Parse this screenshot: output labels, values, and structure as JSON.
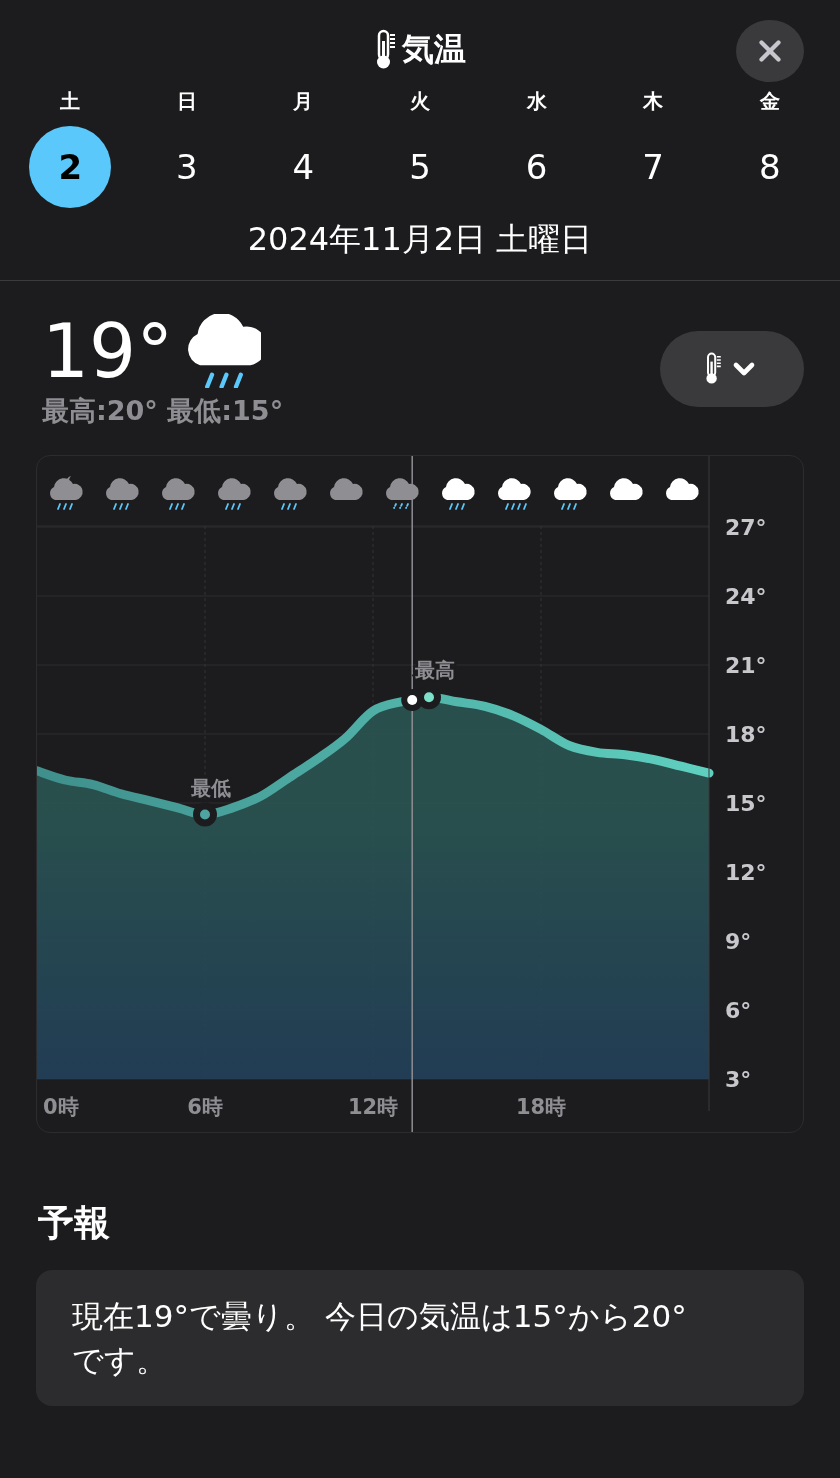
{
  "header": {
    "title": "気温"
  },
  "days": [
    {
      "weekday": "土",
      "date": "2",
      "selected": true
    },
    {
      "weekday": "日",
      "date": "3",
      "selected": false
    },
    {
      "weekday": "月",
      "date": "4",
      "selected": false
    },
    {
      "weekday": "火",
      "date": "5",
      "selected": false
    },
    {
      "weekday": "水",
      "date": "6",
      "selected": false
    },
    {
      "weekday": "木",
      "date": "7",
      "selected": false
    },
    {
      "weekday": "金",
      "date": "8",
      "selected": false
    }
  ],
  "selected_date": "2024年11月2日 土曜日",
  "current": {
    "temperature": "19°",
    "high_low": "最高:20° 最低:15°"
  },
  "conditions": [
    {
      "kind": "night-rain",
      "past": true
    },
    {
      "kind": "rain",
      "past": true
    },
    {
      "kind": "rain",
      "past": true
    },
    {
      "kind": "rain",
      "past": true
    },
    {
      "kind": "rain",
      "past": true
    },
    {
      "kind": "cloud",
      "past": true
    },
    {
      "kind": "drizzle",
      "past": true
    },
    {
      "kind": "rain",
      "past": false
    },
    {
      "kind": "heavy-rain",
      "past": false
    },
    {
      "kind": "rain",
      "past": false
    },
    {
      "kind": "cloud",
      "past": false
    },
    {
      "kind": "cloud",
      "past": false
    }
  ],
  "chart_data": {
    "type": "area",
    "x": [
      0,
      1,
      2,
      3,
      4,
      5,
      6,
      7,
      8,
      9,
      10,
      11,
      12,
      13,
      14,
      15,
      16,
      17,
      18,
      19,
      20,
      21,
      22,
      23,
      24
    ],
    "grid": true,
    "series": [
      {
        "color": "#5fd0c0",
        "values": [
          16.4,
          16.0,
          15.8,
          15.4,
          15.1,
          14.8,
          14.5,
          14.8,
          15.3,
          16.1,
          16.9,
          17.8,
          19.0,
          19.4,
          19.6,
          19.4,
          19.2,
          18.8,
          18.2,
          17.5,
          17.2,
          17.1,
          16.9,
          16.6,
          16.3
        ]
      }
    ],
    "xlim": [
      0,
      24
    ],
    "ylim": [
      3,
      30
    ],
    "xticks": [
      {
        "value": 0,
        "label": "0時"
      },
      {
        "value": 6,
        "label": "6時"
      },
      {
        "value": 12,
        "label": "12時"
      },
      {
        "value": 18,
        "label": "18時"
      }
    ],
    "yticks": [
      {
        "value": 3,
        "label": "3°"
      },
      {
        "value": 6,
        "label": "6°"
      },
      {
        "value": 9,
        "label": "9°"
      },
      {
        "value": 12,
        "label": "12°"
      },
      {
        "value": 15,
        "label": "15°"
      },
      {
        "value": 18,
        "label": "18°"
      },
      {
        "value": 21,
        "label": "21°"
      },
      {
        "value": 24,
        "label": "24°"
      },
      {
        "value": 27,
        "label": "27°"
      }
    ],
    "annotations": [
      {
        "x": 6,
        "y": 14.5,
        "text": "最低"
      },
      {
        "x": 14,
        "y": 19.6,
        "text": "最高"
      }
    ],
    "ref_lines": [
      {
        "axis": "x",
        "value": 13.4
      }
    ]
  },
  "forecast": {
    "heading": "予報",
    "text": "現在19°で曇り。 今日の気温は15°から20°です。"
  }
}
